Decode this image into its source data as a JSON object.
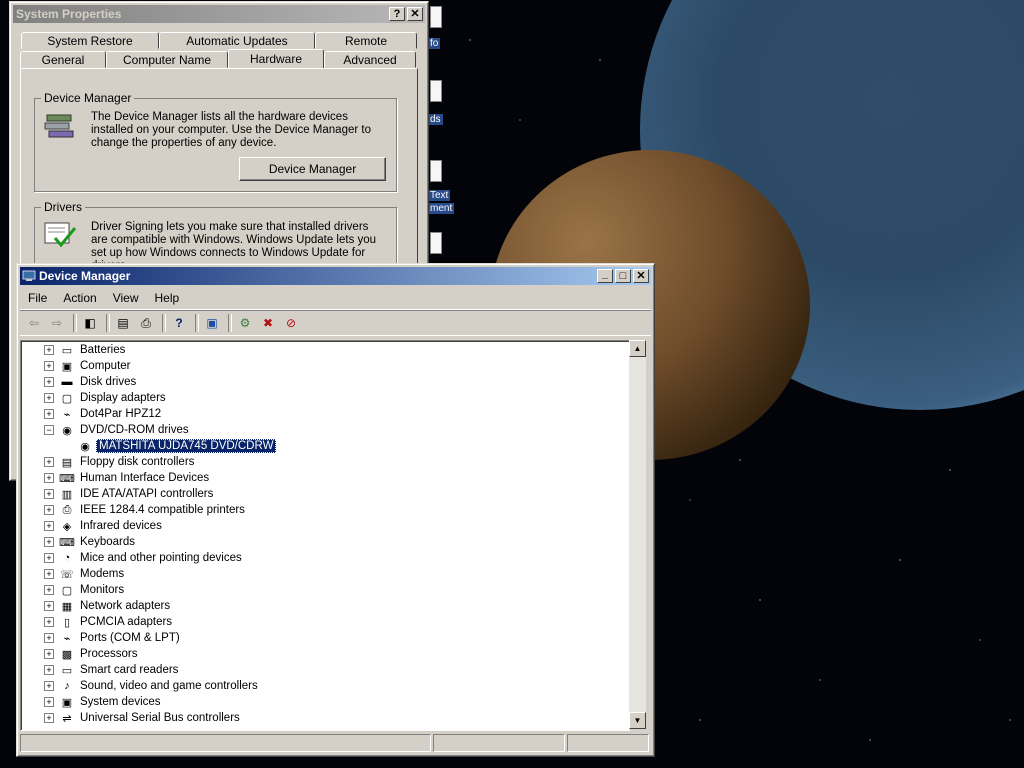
{
  "desktop": {
    "icon_labels": [
      "fo",
      "ds",
      "Text",
      "ment"
    ]
  },
  "system_properties": {
    "title": "System Properties",
    "help_btn": "?",
    "close_btn": "✕",
    "tabs_top": [
      "System Restore",
      "Automatic Updates",
      "Remote"
    ],
    "tabs_bottom": [
      "General",
      "Computer Name",
      "Hardware",
      "Advanced"
    ],
    "selected_tab": "Hardware",
    "device_manager_group": {
      "title": "Device Manager",
      "text": "The Device Manager lists all the hardware devices installed on your computer. Use the Device Manager to change the properties of any device.",
      "button": "Device Manager"
    },
    "drivers_group": {
      "title": "Drivers",
      "text": "Driver Signing lets you make sure that installed drivers are compatible with Windows. Windows Update lets you set up how Windows connects to Windows Update for drivers."
    }
  },
  "device_manager": {
    "title": "Device Manager",
    "menu": [
      "File",
      "Action",
      "View",
      "Help"
    ],
    "tree": [
      {
        "label": "Batteries",
        "icon": "battery-icon",
        "expanded": false
      },
      {
        "label": "Computer",
        "icon": "computer-icon",
        "expanded": false
      },
      {
        "label": "Disk drives",
        "icon": "disk-icon",
        "expanded": false
      },
      {
        "label": "Display adapters",
        "icon": "display-icon",
        "expanded": false
      },
      {
        "label": "Dot4Par HPZ12",
        "icon": "port-icon",
        "expanded": false
      },
      {
        "label": "DVD/CD-ROM drives",
        "icon": "cdrom-icon",
        "expanded": true
      },
      {
        "label": "MATSHITA UJDA745 DVD/CDRW",
        "icon": "cdrom-icon",
        "child": true,
        "selected": true
      },
      {
        "label": "Floppy disk controllers",
        "icon": "floppy-icon",
        "expanded": false
      },
      {
        "label": "Human Interface Devices",
        "icon": "hid-icon",
        "expanded": false
      },
      {
        "label": "IDE ATA/ATAPI controllers",
        "icon": "ide-icon",
        "expanded": false
      },
      {
        "label": "IEEE 1284.4 compatible printers",
        "icon": "printer-icon",
        "expanded": false
      },
      {
        "label": "Infrared devices",
        "icon": "infrared-icon",
        "expanded": false
      },
      {
        "label": "Keyboards",
        "icon": "keyboard-icon",
        "expanded": false
      },
      {
        "label": "Mice and other pointing devices",
        "icon": "mouse-icon",
        "expanded": false
      },
      {
        "label": "Modems",
        "icon": "modem-icon",
        "expanded": false
      },
      {
        "label": "Monitors",
        "icon": "monitor-icon",
        "expanded": false
      },
      {
        "label": "Network adapters",
        "icon": "network-icon",
        "expanded": false
      },
      {
        "label": "PCMCIA adapters",
        "icon": "pcmcia-icon",
        "expanded": false
      },
      {
        "label": "Ports (COM & LPT)",
        "icon": "port-icon",
        "expanded": false
      },
      {
        "label": "Processors",
        "icon": "processor-icon",
        "expanded": false
      },
      {
        "label": "Smart card readers",
        "icon": "smartcard-icon",
        "expanded": false
      },
      {
        "label": "Sound, video and game controllers",
        "icon": "sound-icon",
        "expanded": false
      },
      {
        "label": "System devices",
        "icon": "system-icon",
        "expanded": false
      },
      {
        "label": "Universal Serial Bus controllers",
        "icon": "usb-icon",
        "expanded": false
      }
    ]
  },
  "colors": {
    "selection": "#0a246a",
    "face": "#d4d0c8",
    "active_title_start": "#0a246a",
    "active_title_end": "#a6caf0"
  }
}
